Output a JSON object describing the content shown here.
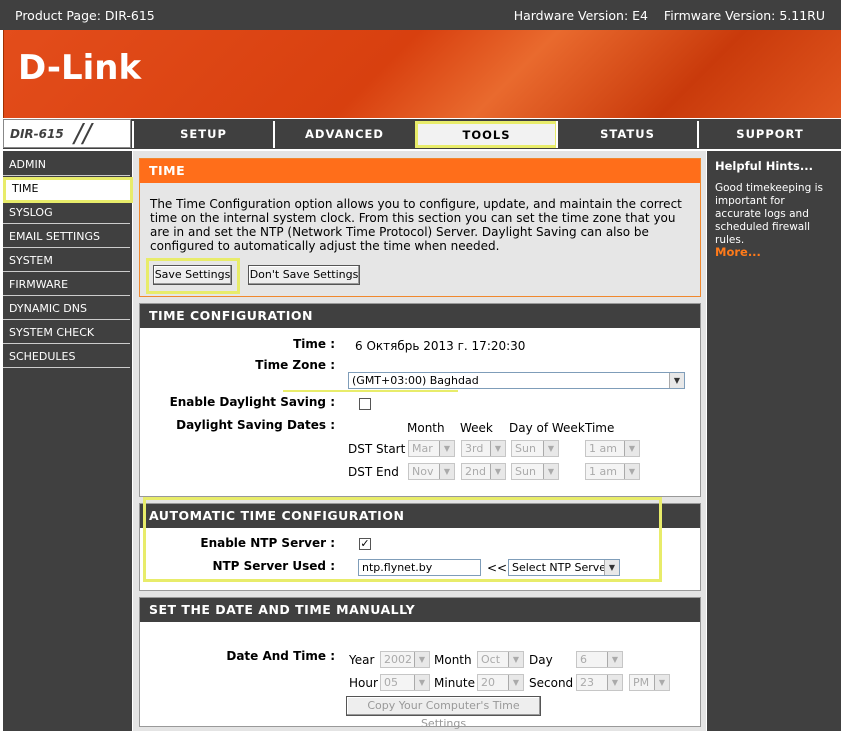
{
  "header": {
    "product_page": "Product Page: DIR-615",
    "versions": "Hardware Version: E4    Firmware Version: 5.11RU",
    "logo": "D-Link",
    "model": "DIR-615"
  },
  "nav": {
    "tabs": [
      "SETUP",
      "ADVANCED",
      "TOOLS",
      "STATUS",
      "SUPPORT"
    ],
    "active": "TOOLS"
  },
  "sidebar": {
    "items": [
      "ADMIN",
      "TIME",
      "SYSLOG",
      "EMAIL SETTINGS",
      "SYSTEM",
      "FIRMWARE",
      "DYNAMIC DNS",
      "SYSTEM CHECK",
      "SCHEDULES"
    ],
    "active": "TIME"
  },
  "intro": {
    "title": "TIME",
    "text": "The Time Configuration option allows you to configure, update, and maintain the correct time on the internal system clock. From this section you can set the time zone that you are in and set the NTP (Network Time Protocol) Server. Daylight Saving can also be configured to automatically adjust the time when needed.",
    "save_label": "Save Settings",
    "dont_save_label": "Don't Save Settings"
  },
  "time_config": {
    "title": "TIME CONFIGURATION",
    "time_label": "Time :",
    "time_value": "6 Октябрь 2013 г. 17:20:30",
    "timezone_label": "Time Zone :",
    "timezone_value": "(GMT+03:00) Baghdad",
    "dst_enable_label": "Enable Daylight Saving :",
    "dst_enable_checked": false,
    "dst_dates_label": "Daylight Saving Dates :",
    "col_month": "Month",
    "col_week": "Week",
    "col_dow": "Day of Week",
    "col_time": "Time",
    "dst_start_label": "DST Start",
    "dst_start": {
      "month": "Mar",
      "week": "3rd",
      "dow": "Sun",
      "time": "1 am"
    },
    "dst_end_label": "DST End",
    "dst_end": {
      "month": "Nov",
      "week": "2nd",
      "dow": "Sun",
      "time": "1 am"
    }
  },
  "auto_time": {
    "title": "AUTOMATIC TIME CONFIGURATION",
    "ntp_enable_label": "Enable NTP Server :",
    "ntp_enable_checked": true,
    "ntp_used_label": "NTP Server Used :",
    "ntp_server_value": "ntp.flynet.by",
    "arrows": "<<",
    "ntp_select_value": "Select NTP Server"
  },
  "manual": {
    "title": "SET THE DATE AND TIME MANUALLY",
    "date_time_label": "Date And Time :",
    "year_label": "Year",
    "year_value": "2002",
    "month_label": "Month",
    "month_value": "Oct",
    "day_label": "Day",
    "day_value": "6",
    "hour_label": "Hour",
    "hour_value": "05",
    "minute_label": "Minute",
    "minute_value": "20",
    "second_label": "Second",
    "second_value": "23",
    "ampm_value": "PM",
    "copy_label": "Copy Your Computer's Time Settings"
  },
  "hints": {
    "title": "Helpful Hints...",
    "text": "Good timekeeping is important for accurate logs and scheduled firewall rules.",
    "more": "More..."
  },
  "colors": {
    "brand_orange": "#e34d1b",
    "dark": "#404040",
    "highlight": "#e8ec6a",
    "link": "#ff7a1a"
  }
}
